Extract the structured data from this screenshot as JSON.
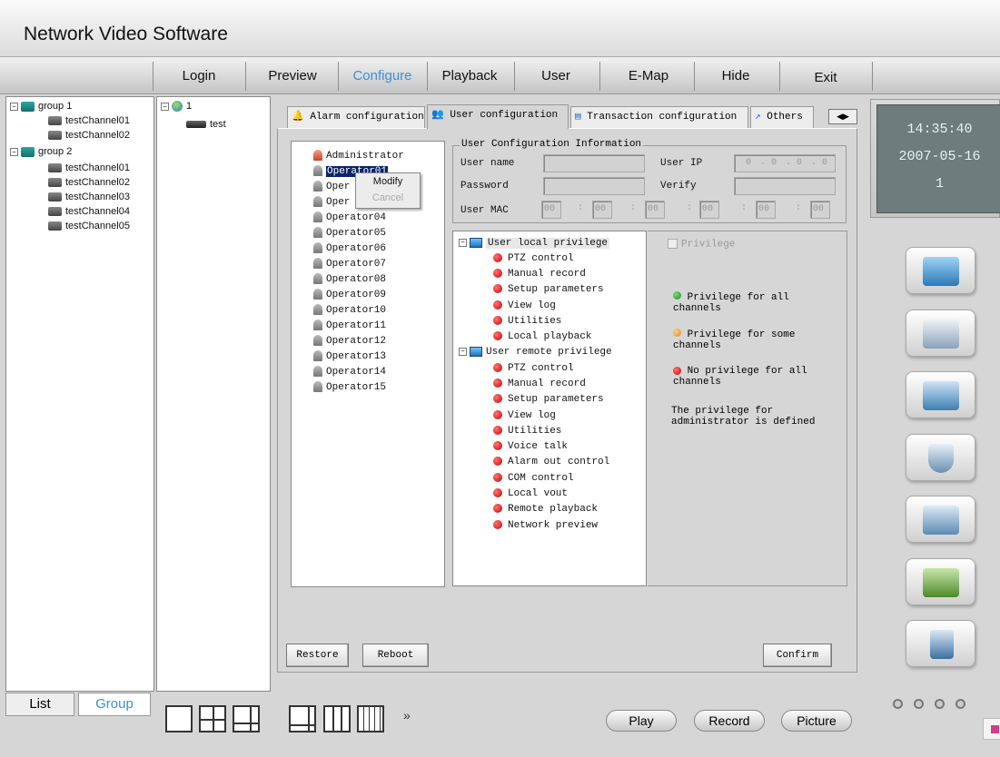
{
  "app": {
    "title": "Network Video Software"
  },
  "menu": {
    "items": [
      "Login",
      "Preview",
      "Configure",
      "Playback",
      "User",
      "E-Map",
      "Hide",
      "Exit"
    ],
    "active": "Configure"
  },
  "device_tree": {
    "groups": [
      {
        "label": "group 1",
        "channels": [
          "testChannel01",
          "testChannel02"
        ]
      },
      {
        "label": "group 2",
        "channels": [
          "testChannel01",
          "testChannel02",
          "testChannel03",
          "testChannel04",
          "testChannel05"
        ]
      }
    ]
  },
  "server_tree": {
    "root": "1",
    "child": "test"
  },
  "tabs": [
    "Alarm configuration",
    "User configuration",
    "Transaction configuration",
    "Others"
  ],
  "active_tab": "User configuration",
  "users": [
    "Administrator",
    "Operator01",
    "Oper",
    "Oper",
    "Operator04",
    "Operator05",
    "Operator06",
    "Operator07",
    "Operator08",
    "Operator09",
    "Operator10",
    "Operator11",
    "Operator12",
    "Operator13",
    "Operator14",
    "Operator15"
  ],
  "context_menu": {
    "modify": "Modify",
    "cancel": "Cancel"
  },
  "user_info": {
    "legend": "User Configuration Information",
    "user_name_label": "User name",
    "user_ip_label": "User IP",
    "password_label": "Password",
    "verify_label": "Verify",
    "user_mac_label": "User MAC",
    "ip_segments": [
      "0",
      "0",
      "0",
      "0"
    ],
    "mac_segments": [
      "00",
      "00",
      "00",
      "00",
      "00",
      "00"
    ]
  },
  "privileges": {
    "local_label": "User local privilege",
    "local": [
      "PTZ control",
      "Manual record",
      "Setup parameters",
      "View log",
      "Utilities",
      "Local playback"
    ],
    "remote_label": "User remote privilege",
    "remote": [
      "PTZ control",
      "Manual record",
      "Setup parameters",
      "View log",
      "Utilities",
      "Voice talk",
      "Alarm out control",
      "COM control",
      "Local vout",
      "Remote playback",
      "Network preview"
    ]
  },
  "legend_panel": {
    "privilege_checkbox": "Privilege",
    "all": "Privilege for all channels",
    "some": "Privilege for some channels",
    "none": "No privilege for all channels",
    "note": "The privilege for administrator is defined"
  },
  "buttons": {
    "restore": "Restore",
    "reboot": "Reboot",
    "confirm": "Confirm"
  },
  "clock": {
    "time": "14:35:40",
    "date": "2007-05-16",
    "day": "1"
  },
  "bottom_tabs": {
    "list": "List",
    "group": "Group"
  },
  "playback_buttons": {
    "play": "Play",
    "record": "Record",
    "picture": "Picture"
  },
  "more_glyph": "»",
  "colors": {
    "accent": "#3b8fd6",
    "clock_bg": "#6d7c7c",
    "clock_text": "#e8f2f2"
  }
}
